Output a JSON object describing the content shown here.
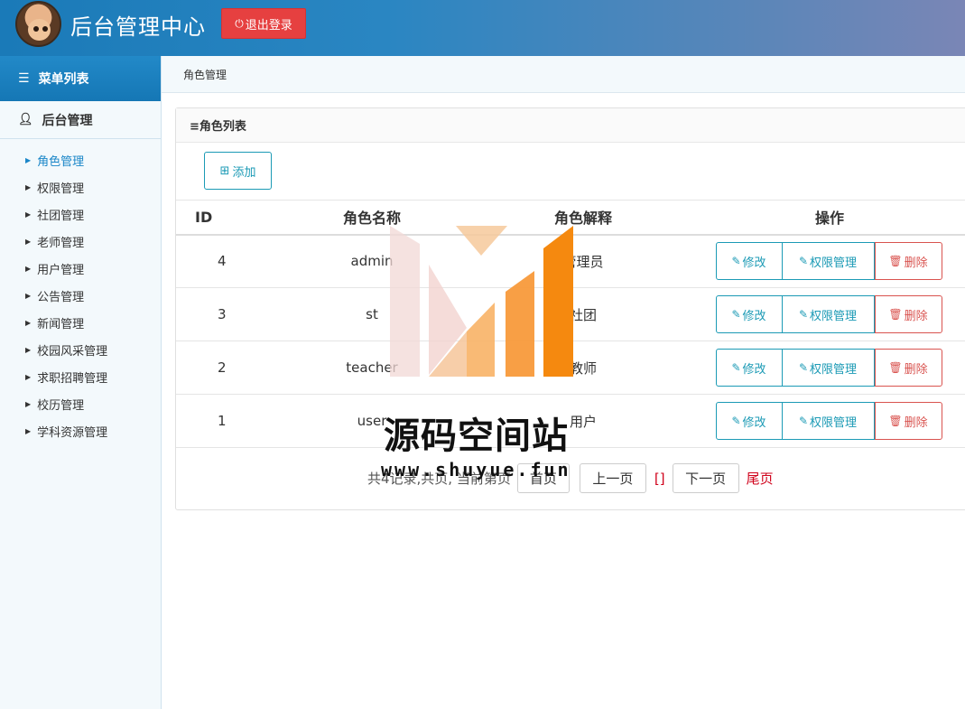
{
  "header": {
    "title": "后台管理中心",
    "logout_label": "退出登录",
    "logout_color": "#e64040"
  },
  "sidebar": {
    "menu_title": "菜单列表",
    "group_title": "后台管理",
    "items": [
      {
        "label": "角色管理",
        "active": true
      },
      {
        "label": "权限管理"
      },
      {
        "label": "社团管理"
      },
      {
        "label": "老师管理"
      },
      {
        "label": "用户管理"
      },
      {
        "label": "公告管理"
      },
      {
        "label": "新闻管理"
      },
      {
        "label": "校园风采管理"
      },
      {
        "label": "求职招聘管理"
      },
      {
        "label": "校历管理"
      },
      {
        "label": "学科资源管理"
      }
    ]
  },
  "breadcrumb": "角色管理",
  "panel": {
    "title": "≡角色列表",
    "add_label": "添加"
  },
  "table": {
    "headers": {
      "id": "ID",
      "name": "角色名称",
      "desc": "角色解释",
      "ops": "操作"
    },
    "rows": [
      {
        "id": "4",
        "name": "admin",
        "desc": "管理员"
      },
      {
        "id": "3",
        "name": "st",
        "desc": "社团"
      },
      {
        "id": "2",
        "name": "teacher",
        "desc": "教师"
      },
      {
        "id": "1",
        "name": "user",
        "desc": "用户"
      }
    ],
    "op_labels": {
      "edit": "修改",
      "perm": "权限管理",
      "del": "删除"
    }
  },
  "pager": {
    "info": "共4记录,共页, 当前第页",
    "first": "首页",
    "prev": "上一页",
    "current": "[]",
    "next": "下一页",
    "last": "尾页"
  },
  "watermark": {
    "text": "源码空间站",
    "url": "www.shuyue.fun"
  },
  "colors": {
    "accent": "#1a86c8",
    "info_border": "#1b9ab5",
    "danger": "#d9534f"
  }
}
